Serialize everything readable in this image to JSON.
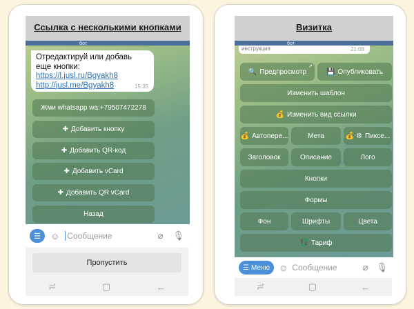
{
  "left": {
    "title": "Ссылка с несколькими кнопками",
    "peek_text": "бот",
    "message": {
      "text": "Отредактируй или добавь еще кнопки:",
      "link1": "https://l.jusl.ru/Bgyakh8",
      "link2": "http://jusl.me/Bgyakh8",
      "time": "15:35"
    },
    "buttons": [
      {
        "icon": "",
        "label": "Жми whatsapp wa:+79507472278"
      },
      {
        "icon": "✚",
        "label": "Добавить кнопку"
      },
      {
        "icon": "✚",
        "label": "Добавить QR-код"
      },
      {
        "icon": "✚",
        "label": "Добавить vCard"
      },
      {
        "icon": "✚",
        "label": "Добавить QR vCard"
      },
      {
        "icon": "",
        "label": "Назад"
      }
    ],
    "input_placeholder": "Сообщение",
    "skip_label": "Пропустить"
  },
  "right": {
    "title": "Визитка",
    "peek_text": "бот",
    "peek_text2": "инструкция",
    "peek_time": "21:08",
    "buttons": [
      {
        "icon": "🔍",
        "label": "Предпросмотр"
      },
      {
        "icon": "💾",
        "label": "Опубликовать"
      },
      {
        "icon": "",
        "label": "Изменить шаблон"
      },
      {
        "icon": "💰",
        "label": "Изменить вид ссылки"
      },
      {
        "icon": "💰",
        "label": "Автопере..."
      },
      {
        "icon": "",
        "label": "Мета"
      },
      {
        "icon": "💰 ⚙",
        "label": "Пиксе..."
      },
      {
        "icon": "",
        "label": "Заголовок"
      },
      {
        "icon": "",
        "label": "Описание"
      },
      {
        "icon": "",
        "label": "Лого"
      },
      {
        "icon": "",
        "label": "Кнопки"
      },
      {
        "icon": "",
        "label": "Формы"
      },
      {
        "icon": "",
        "label": "Фон"
      },
      {
        "icon": "",
        "label": "Шрифты"
      },
      {
        "icon": "",
        "label": "Цвета"
      },
      {
        "icon": "💱",
        "label": "Тариф"
      }
    ],
    "menu_label": "Меню",
    "input_placeholder": "Сообщение"
  }
}
